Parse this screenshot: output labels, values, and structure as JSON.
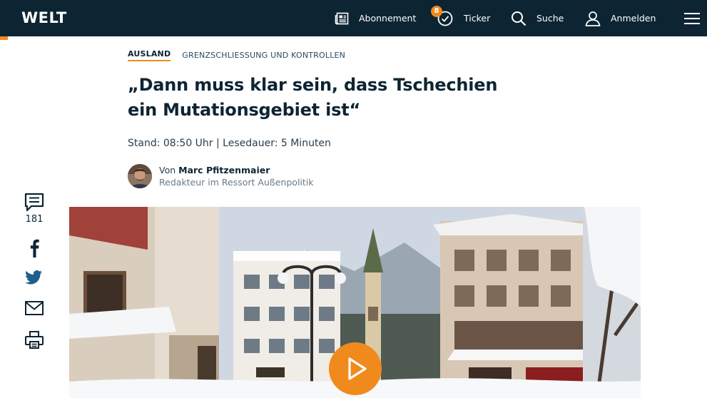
{
  "header": {
    "logo": "WELT",
    "nav": {
      "abonnement": "Abonnement",
      "ticker": "Ticker",
      "ticker_badge": "8",
      "suche": "Suche",
      "anmelden": "Anmelden"
    },
    "icons": [
      "newspaper-icon",
      "ticker-check-icon",
      "search-icon",
      "user-icon",
      "hamburger-menu-icon"
    ],
    "colors": {
      "bar": "#0d2433",
      "accent": "#f08a1d"
    }
  },
  "article": {
    "breadcrumb": {
      "section": "AUSLAND",
      "topic": "GRENZSCHLIESSUNG UND KONTROLLEN"
    },
    "headline": "„Dann muss klar sein, dass Tschechien ein Mutationsgebiet ist“",
    "meta": "Stand: 08:50 Uhr | Lesedauer: 5 Minuten",
    "author": {
      "prefix": "Von",
      "name": "Marc Pfitzenmaier",
      "role": "Redakteur im Ressort Außenpolitik"
    }
  },
  "share_rail": {
    "comments_count": "181",
    "icons": [
      "comments-icon",
      "facebook-icon",
      "twitter-icon",
      "email-icon",
      "print-icon"
    ]
  },
  "video": {
    "icon": "play-icon"
  }
}
